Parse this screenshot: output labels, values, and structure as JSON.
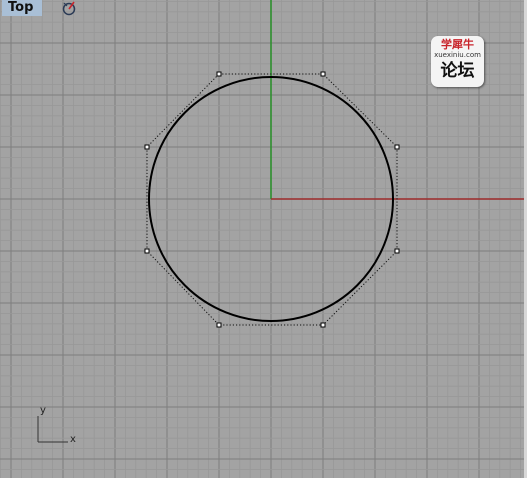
{
  "viewport": {
    "name": "Top",
    "background": "#a3a3a3",
    "minor_grid_color": "#989898",
    "major_grid_color": "#7e7e7e",
    "x_axis_color": "#9c2b2b",
    "y_axis_color": "#2d8f2d"
  },
  "logo": {
    "line1": "学犀牛",
    "line2": "xuexiniu.com",
    "line3": "论坛"
  },
  "axis_indicator": {
    "x_label": "x",
    "y_label": "y"
  },
  "icons": {
    "rotate": "rotate-view-icon"
  }
}
